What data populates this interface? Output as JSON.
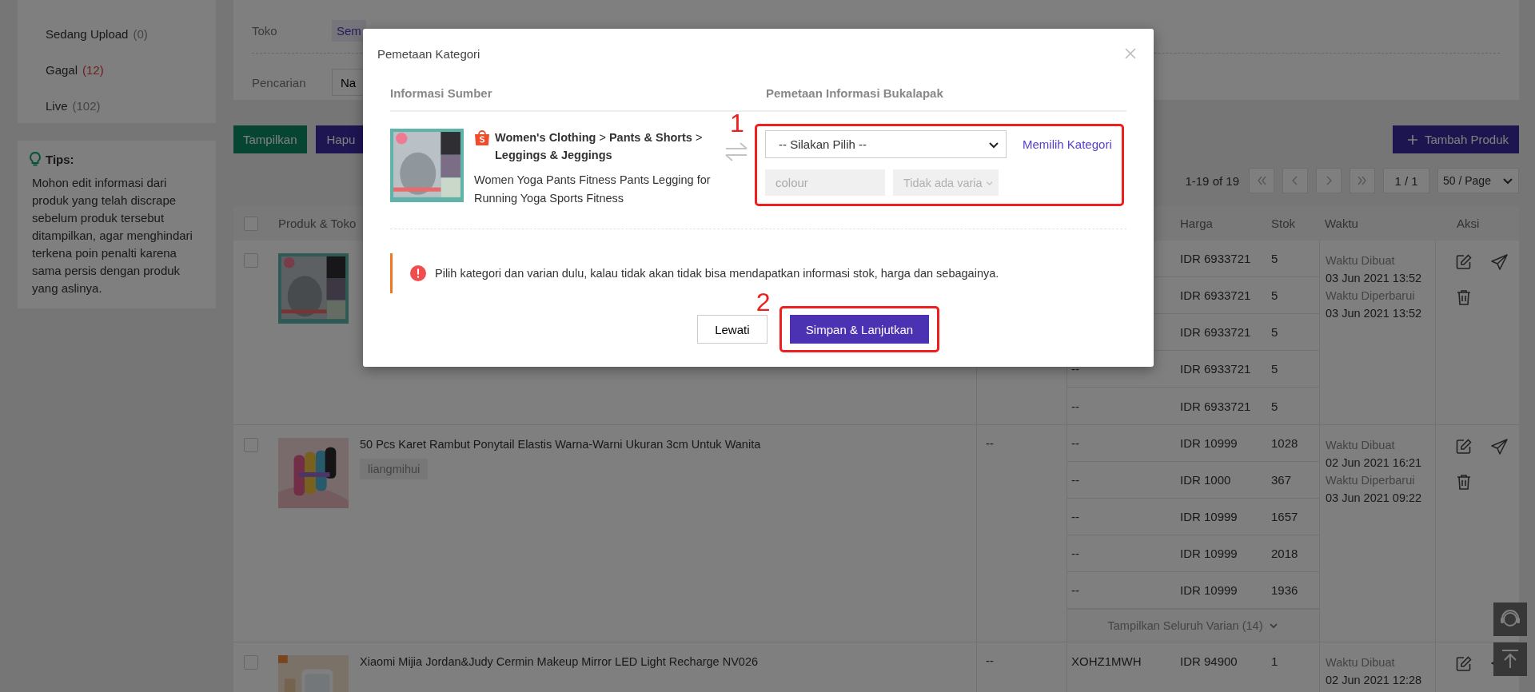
{
  "sidebar": {
    "status_items": [
      {
        "label": "Sedang Upload",
        "count": "(0)",
        "kind": "normal"
      },
      {
        "label": "Gagal",
        "count": "(12)",
        "kind": "error"
      },
      {
        "label": "Live",
        "count": "(102)",
        "kind": "normal"
      }
    ],
    "tips": {
      "title": "Tips:",
      "text": "Mohon edit informasi dari produk yang telah discrape sebelum produk tersebut ditampilkan, agar menghindari terkena poin penalti karena sama persis dengan produk yang aslinya."
    }
  },
  "filter": {
    "rows": [
      {
        "label": "Toko",
        "kind": "chip",
        "value": "Sem"
      },
      {
        "label": "Pencarian",
        "kind": "input",
        "value": "Na"
      }
    ]
  },
  "toolbar": {
    "buttons": [
      {
        "label": "Tampilkan",
        "kind": "green"
      },
      {
        "label": "Hapu",
        "kind": "purple"
      }
    ],
    "add_button": "Tambah Produk"
  },
  "pagination": {
    "range": "1-19 of 19",
    "page": "1 / 1",
    "page_size": "50 / Page"
  },
  "table": {
    "select_all_checked": false,
    "columns": [
      {
        "label": "Produk & Toko",
        "kind": "product"
      },
      {
        "label": "Harga",
        "kind": "price"
      },
      {
        "label": "Stok",
        "kind": "stock"
      },
      {
        "label": "Waktu",
        "kind": "time"
      },
      {
        "label": "Aksi",
        "kind": "actions"
      }
    ],
    "rows": [
      {
        "checked": false,
        "variants": [
          {
            "price": "IDR 6933721",
            "stock": "5"
          },
          {
            "price": "IDR 6933721",
            "stock": "5"
          },
          {
            "price": "IDR 6933721",
            "stock": "5"
          },
          {
            "sku": "--",
            "price": "IDR 6933721",
            "stock": "5"
          },
          {
            "sku": "--",
            "price": "IDR 6933721",
            "stock": "5"
          }
        ],
        "times": [
          "Waktu Dibuat",
          "03 Jun 2021 13:52",
          "Waktu Diperbarui",
          "03 Jun 2021 13:52"
        ],
        "actions": [
          {
            "kind": "edit"
          },
          {
            "kind": "send"
          },
          {
            "kind": "delete"
          }
        ]
      },
      {
        "checked": false,
        "title": "50 Pcs Karet Rambut Ponytail Elastis Warna-Warni Ukuran 3cm Untuk Wanita",
        "shop": "liangmihui",
        "extra": "--",
        "variants": [
          {
            "sku": "--",
            "price": "IDR 10999",
            "stock": "1028"
          },
          {
            "sku": "--",
            "price": "IDR 1000",
            "stock": "367"
          },
          {
            "sku": "--",
            "price": "IDR 10999",
            "stock": "1657"
          },
          {
            "sku": "--",
            "price": "IDR 10999",
            "stock": "2018"
          },
          {
            "sku": "--",
            "price": "IDR 10999",
            "stock": "1936"
          }
        ],
        "times": [
          "Waktu Dibuat",
          "02 Jun 2021 16:21",
          "Waktu Diperbarui",
          "03 Jun 2021 09:22"
        ],
        "show_all": "Tampilkan Seluruh Varian (14)",
        "actions": [
          {
            "kind": "edit"
          },
          {
            "kind": "send"
          },
          {
            "kind": "delete"
          }
        ]
      },
      {
        "checked": false,
        "title": "Xiaomi Mijia Jordan&Judy Cermin Makeup Mirror LED Light Recharge NV026",
        "extra": "--",
        "variants": [
          {
            "sku": "XOHZ1MWH",
            "price": "IDR 94900",
            "stock": "1"
          }
        ],
        "times": [
          "Waktu Dibuat",
          "02 Jun 2021 12:28"
        ],
        "actions": [
          {
            "kind": "edit"
          },
          {
            "kind": "send"
          }
        ]
      }
    ]
  },
  "modal": {
    "title": "Pemetaan Kategori",
    "source_header": "Informasi Sumber",
    "target_header": "Pemetaan Informasi Bukalapak",
    "product": {
      "category": "**Women's Clothing** > **Pants & Shorts** > **Leggings & Jeggings**",
      "title": "Women Yoga Pants Fitness Pants Legging for Running Yoga Sports Fitness"
    },
    "category_select": {
      "value": "-- Silakan Pilih --"
    },
    "link": "Memilih Kategori",
    "variant_field": {
      "value": "colour",
      "disabled": true
    },
    "variant_select": {
      "value": "Tidak ada varia",
      "disabled": true
    },
    "warning": "Pilih kategori dan varian dulu, kalau tidak akan tidak bisa mendapatkan informasi stok, harga dan sebagainya.",
    "buttons": [
      {
        "label": "Lewati",
        "kind": "secondary"
      },
      {
        "label": "Simpan & Lanjutkan",
        "kind": "primary"
      }
    ],
    "markers": [
      "1",
      "2"
    ]
  }
}
